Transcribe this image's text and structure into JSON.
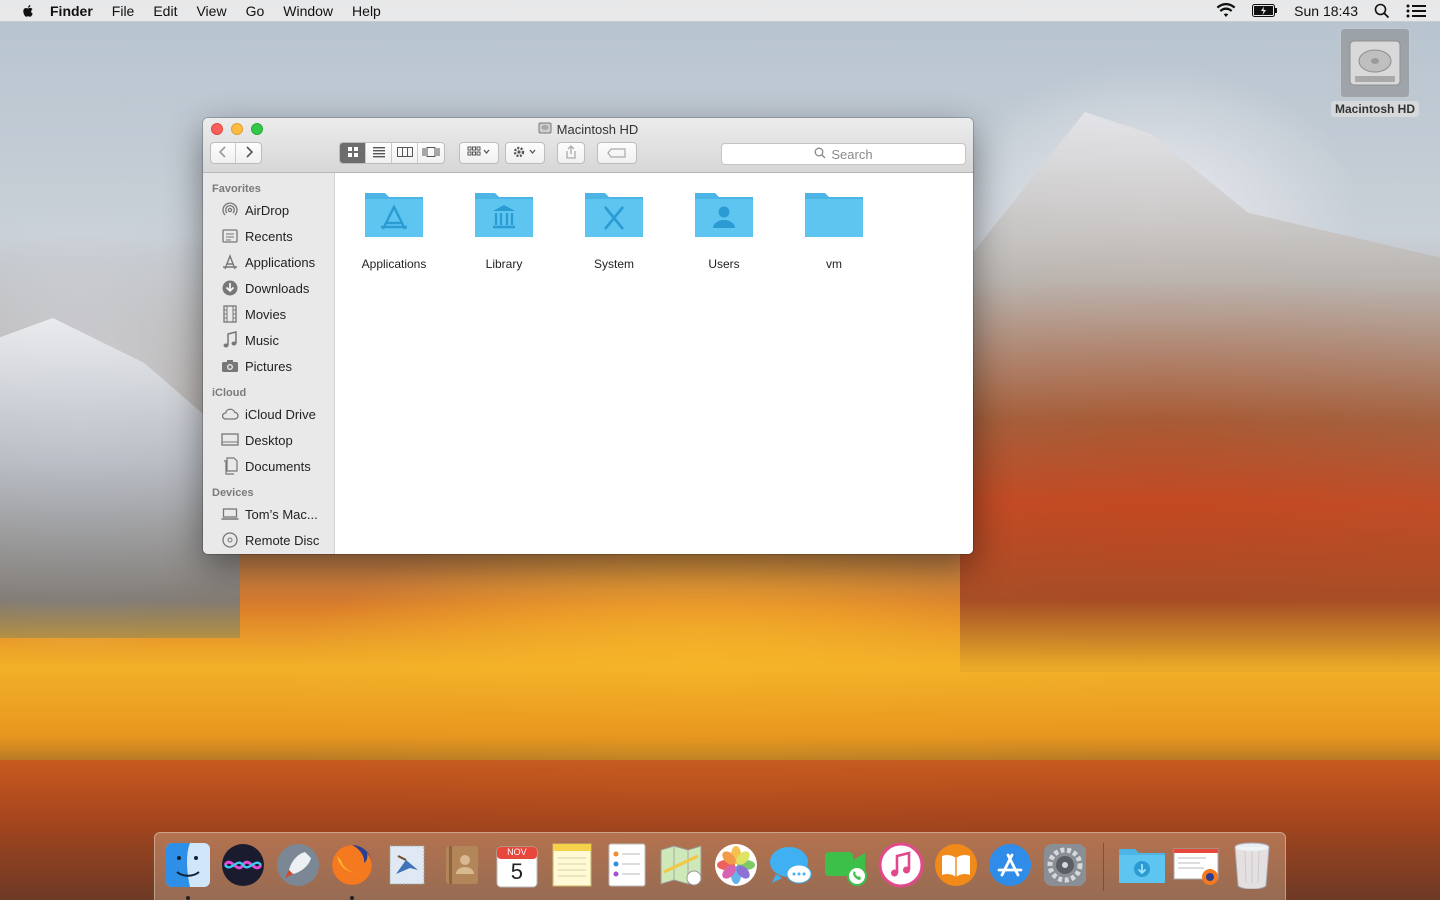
{
  "menubar": {
    "app_name": "Finder",
    "menus": [
      "File",
      "Edit",
      "View",
      "Go",
      "Window",
      "Help"
    ],
    "clock": "Sun 18:43"
  },
  "desktop": {
    "disk_label": "Macintosh HD"
  },
  "window": {
    "title": "Macintosh HD",
    "search_placeholder": "Search"
  },
  "sidebar": {
    "favorites_header": "Favorites",
    "favorites": [
      {
        "label": "AirDrop",
        "icon": "airdrop-icon"
      },
      {
        "label": "Recents",
        "icon": "recents-icon"
      },
      {
        "label": "Applications",
        "icon": "applications-icon"
      },
      {
        "label": "Downloads",
        "icon": "downloads-icon"
      },
      {
        "label": "Movies",
        "icon": "movies-icon"
      },
      {
        "label": "Music",
        "icon": "music-icon"
      },
      {
        "label": "Pictures",
        "icon": "pictures-icon"
      }
    ],
    "icloud_header": "iCloud",
    "icloud": [
      {
        "label": "iCloud Drive",
        "icon": "cloud-icon"
      },
      {
        "label": "Desktop",
        "icon": "desktop-icon"
      },
      {
        "label": "Documents",
        "icon": "documents-icon"
      }
    ],
    "devices_header": "Devices",
    "devices": [
      {
        "label": "Tom’s Mac...",
        "icon": "laptop-icon"
      },
      {
        "label": "Remote Disc",
        "icon": "disc-icon"
      }
    ]
  },
  "files": [
    {
      "name": "Applications",
      "icon": "applications-folder-icon"
    },
    {
      "name": "Library",
      "icon": "library-folder-icon"
    },
    {
      "name": "System",
      "icon": "system-folder-icon"
    },
    {
      "name": "Users",
      "icon": "users-folder-icon"
    },
    {
      "name": "vm",
      "icon": "folder-icon"
    }
  ],
  "dock": {
    "calendar_month": "NOV",
    "calendar_day": "5",
    "apps": [
      "Finder",
      "Siri",
      "Launchpad",
      "Firefox",
      "Mail",
      "Contacts",
      "Calendar",
      "Notes",
      "Reminders",
      "Maps",
      "Photos",
      "Messages",
      "FaceTime",
      "iTunes",
      "iBooks",
      "App Store",
      "System Preferences"
    ]
  },
  "colors": {
    "folder_blue": "#5ec4f0",
    "folder_tab": "#4cb5e6",
    "folder_glyph": "#2a9bd3"
  }
}
